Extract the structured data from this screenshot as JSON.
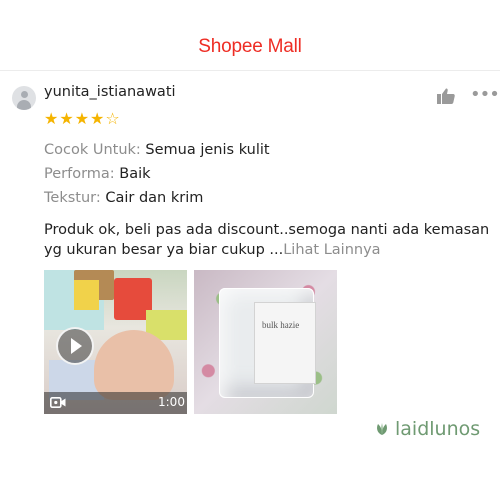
{
  "header": {
    "brand": "Shopee Mall"
  },
  "review": {
    "username": "yunita_istianawati",
    "rating": 4,
    "rating_max": 5,
    "attributes": [
      {
        "label": "Cocok Untuk: ",
        "value": "Semua jenis kulit"
      },
      {
        "label": "Performa: ",
        "value": "Baik"
      },
      {
        "label": "Tekstur: ",
        "value": "Cair dan krim"
      }
    ],
    "text": "Produk ok, beli pas ada discount..semoga nanti ada kemasan yg ukuran besar ya biar cukup ...",
    "more_link": "Lihat Lainnya",
    "media": {
      "video_duration": "1:00",
      "photo_brand": "bulk hazie"
    }
  },
  "watermark": "laidlunos",
  "colors": {
    "brand": "#ee2d24",
    "star": "#f5b400",
    "muted": "#8d8d8d",
    "watermark": "#6f9a72"
  }
}
